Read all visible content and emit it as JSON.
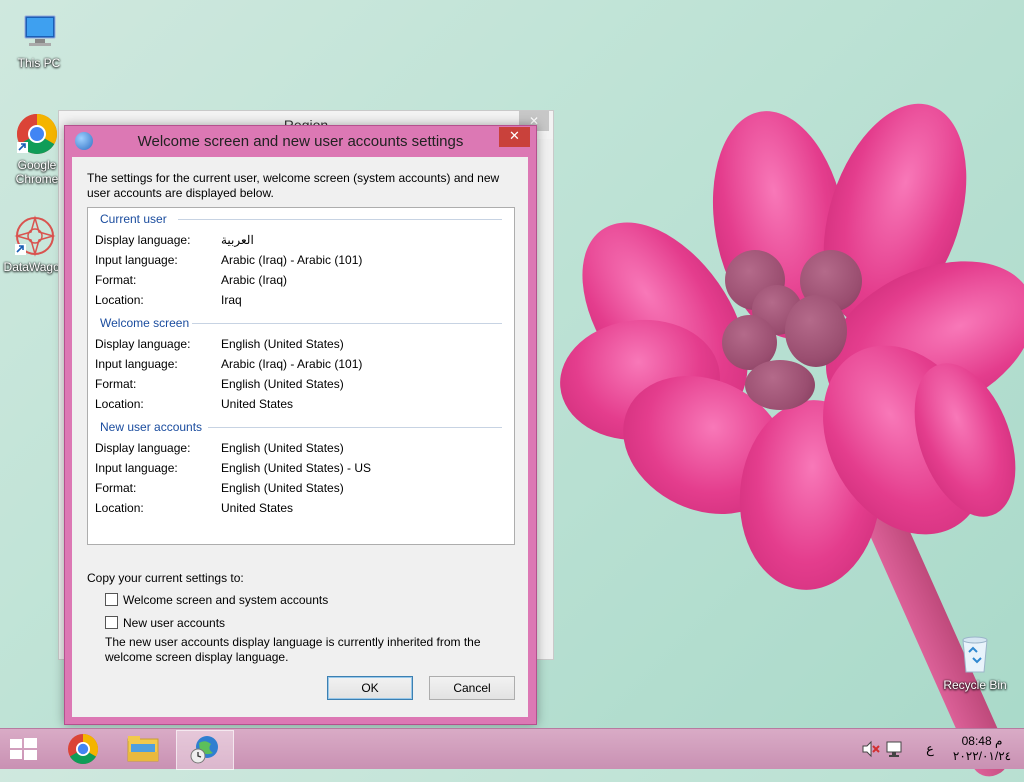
{
  "desktop": {
    "icons": [
      {
        "label": "This PC"
      },
      {
        "label": "Google Chrome"
      },
      {
        "label": "DataWagon"
      },
      {
        "label": "Recycle Bin"
      }
    ]
  },
  "region_window": {
    "title": "Region",
    "close_glyph": "✕"
  },
  "dialog": {
    "title": "Welcome screen and new user accounts settings",
    "close_glyph": "✕",
    "intro": "The settings for the current user, welcome screen (system accounts) and new user accounts are displayed below.",
    "sections": [
      {
        "heading": "Current user",
        "rows": [
          {
            "label": "Display language:",
            "value": "العربية"
          },
          {
            "label": "Input language:",
            "value": "Arabic (Iraq) - Arabic (101)"
          },
          {
            "label": "Format:",
            "value": "Arabic (Iraq)"
          },
          {
            "label": "Location:",
            "value": "Iraq"
          }
        ]
      },
      {
        "heading": "Welcome screen",
        "rows": [
          {
            "label": "Display language:",
            "value": "English (United States)"
          },
          {
            "label": "Input language:",
            "value": "Arabic (Iraq) - Arabic (101)"
          },
          {
            "label": "Format:",
            "value": "English (United States)"
          },
          {
            "label": "Location:",
            "value": "United States"
          }
        ]
      },
      {
        "heading": "New user accounts",
        "rows": [
          {
            "label": "Display language:",
            "value": "English (United States)"
          },
          {
            "label": "Input language:",
            "value": "English (United States) - US"
          },
          {
            "label": "Format:",
            "value": "English (United States)"
          },
          {
            "label": "Location:",
            "value": "United States"
          }
        ]
      }
    ],
    "copy_label": "Copy your current settings to:",
    "checkboxes": [
      {
        "label": "Welcome screen and system accounts",
        "checked": false
      },
      {
        "label": "New user accounts",
        "checked": false
      }
    ],
    "note": "The new user accounts display language is currently inherited from the welcome screen display language.",
    "ok_label": "OK",
    "cancel_label": "Cancel"
  },
  "taskbar": {
    "items": [
      {
        "icon": "start-icon"
      },
      {
        "icon": "chrome-icon"
      },
      {
        "icon": "file-explorer-icon"
      },
      {
        "icon": "region-control-panel-icon",
        "active": true
      }
    ],
    "tray": {
      "language_indicator": "ع",
      "time": "08:48 م",
      "date": "٢٠٢٢/٠١/٢٤"
    }
  },
  "colors": {
    "dialog_frame": "#dc78b4",
    "taskbar": "#d9abc6",
    "close_button": "#c9413b",
    "section_heading": "#1a4c9e"
  }
}
